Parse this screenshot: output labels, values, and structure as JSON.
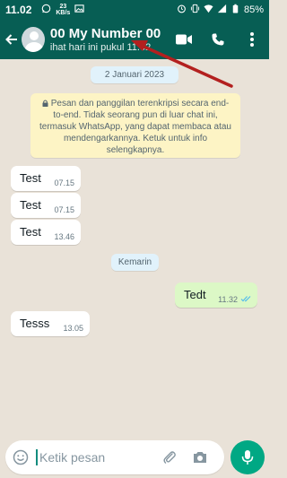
{
  "status_bar": {
    "time": "11.02",
    "network_rate_value": "23",
    "network_rate_unit": "KB/s",
    "battery": "85%",
    "icons": [
      "whatsapp-icon",
      "image-icon",
      "alarm-icon",
      "vibrate-icon",
      "wifi-icon",
      "signal-icon",
      "battery-icon"
    ]
  },
  "header": {
    "contact_name": "00 My Number 00",
    "last_seen": "ihat hari ini pukul 11.02",
    "icons": [
      "back-arrow-icon",
      "avatar-icon",
      "video-call-icon",
      "voice-call-icon",
      "more-options-icon"
    ]
  },
  "chat": {
    "date_chip": "2 Januari 2023",
    "e2e_notice": "Pesan dan panggilan terenkripsi secara end-to-end. Tidak seorang pun di luar chat ini, termasuk WhatsApp, yang dapat membaca atau mendengarkannya. Ketuk untuk info selengkapnya.",
    "divider_chip": "Kemarin",
    "messages": [
      {
        "direction": "in",
        "text": "Test",
        "time": "07.15"
      },
      {
        "direction": "in",
        "text": "Test",
        "time": "07.15"
      },
      {
        "direction": "in",
        "text": "Test",
        "time": "13.46"
      },
      {
        "direction": "out",
        "text": "Tedt",
        "time": "11.32",
        "status": "read"
      },
      {
        "direction": "in",
        "text": "Tesss",
        "time": "13.05"
      }
    ]
  },
  "composer": {
    "placeholder": "Ketik pesan",
    "icons": [
      "emoji-icon",
      "attach-icon",
      "camera-icon",
      "mic-icon"
    ]
  },
  "colors": {
    "header": "#075e54",
    "accent": "#00a884",
    "outgoing_bubble": "#dcf8c6",
    "chat_background": "#e9e2d8",
    "notice_background": "#fdf4c5",
    "annotation_arrow": "#b3201f"
  }
}
